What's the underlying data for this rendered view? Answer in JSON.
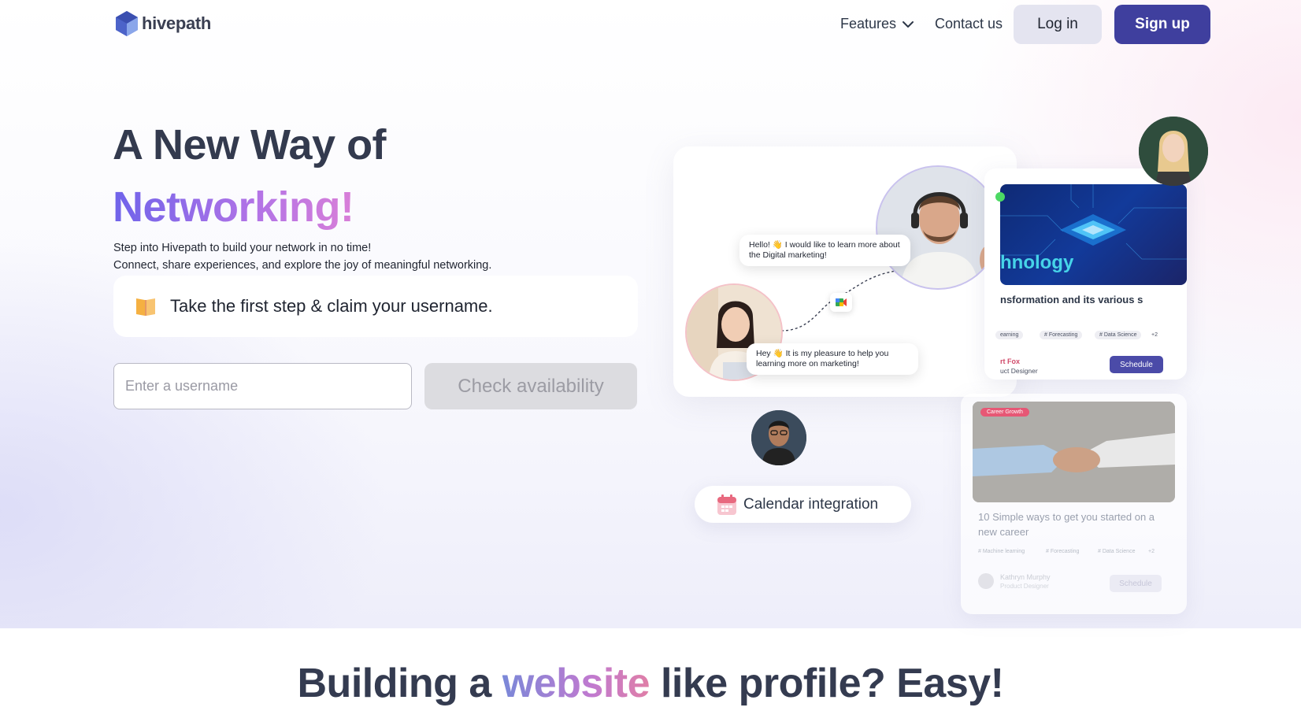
{
  "nav": {
    "logo_text": "hivepath",
    "features_label": "Features",
    "contact_label": "Contact us",
    "login_label": "Log in",
    "signup_label": "Sign up"
  },
  "hero": {
    "title_line1": "A New Way of",
    "title_line2": "Networking!",
    "subtitle_line1": "Step into Hivepath to build your network in no time!",
    "subtitle_line2": "Connect, share experiences, and explore the joy of meaningful networking.",
    "claim_text": "Take the first step & claim your username.",
    "username_placeholder": "Enter a username",
    "username_value": "",
    "check_label": "Check availability"
  },
  "illustration": {
    "bubble_top": "Hello! 👋 I would like to learn more about the Digital marketing!",
    "bubble_bottom": "Hey 👋 It is my pleasure to help you learning more on marketing!",
    "tech_card": {
      "banner_word": "hnology",
      "title": "nsformation and its various s",
      "tags": [
        "earning",
        "# Forecasting",
        "# Data Science",
        "+2"
      ],
      "author": "rt Fox",
      "role": "uct Designer",
      "schedule_label": "Schedule"
    },
    "career_card": {
      "badge": "Career Growth",
      "title": "10 Simple ways to get you started on a new career",
      "tags": [
        "# Machine learning",
        "# Forecasting",
        "# Data Science",
        "+2"
      ],
      "author": "Kathryn Murphy",
      "role": "Product Designer",
      "schedule_label": "Schedule"
    },
    "calendar_label": "Calendar integration"
  },
  "section2": {
    "title_part1": "Building a ",
    "title_highlight": "website",
    "title_part2": " like profile? Easy!"
  },
  "colors": {
    "brand": "#3f3f9e",
    "heading": "#333a4e",
    "gradient_start": "#6f63ea",
    "gradient_end": "#d97fd8"
  },
  "icons": [
    "hive-logo-icon",
    "chevron-down-icon",
    "book-icon",
    "video-call-icon",
    "calendar-icon"
  ]
}
